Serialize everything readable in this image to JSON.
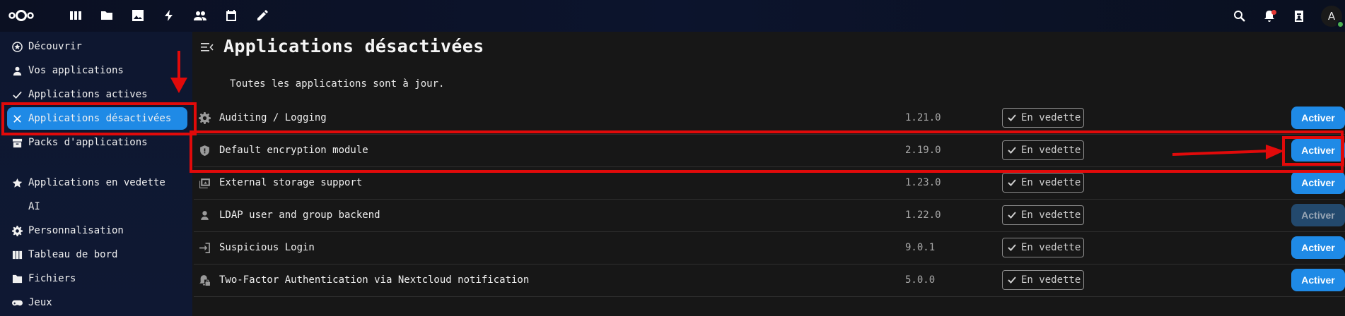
{
  "header": {
    "nav_icons": [
      "dashboard-icon",
      "files-icon",
      "photos-icon",
      "activity-icon",
      "contacts-icon",
      "calendar-icon",
      "notes-icon"
    ],
    "right_icons": [
      "search-icon",
      "notifications-icon",
      "contacts-menu-icon"
    ],
    "avatar_letter": "A"
  },
  "sidebar": {
    "items": [
      {
        "label": "Découvrir",
        "icon": "star-circle-icon"
      },
      {
        "label": "Vos applications",
        "icon": "account-icon"
      },
      {
        "label": "Applications actives",
        "icon": "check-icon"
      },
      {
        "label": "Applications désactivées",
        "icon": "close-icon"
      },
      {
        "label": "Packs d'applications",
        "icon": "archive-icon"
      },
      {
        "label": "Applications en vedette",
        "icon": "star-icon"
      },
      {
        "label": "AI",
        "icon": ""
      },
      {
        "label": "Personnalisation",
        "icon": "cog-icon"
      },
      {
        "label": "Tableau de bord",
        "icon": "dashboard-icon"
      },
      {
        "label": "Fichiers",
        "icon": "folder-icon"
      },
      {
        "label": "Jeux",
        "icon": "gamepad-icon"
      }
    ]
  },
  "main": {
    "title": "Applications désactivées",
    "status": "Toutes les applications sont à jour.",
    "featured_label": "En vedette",
    "activate_label": "Activer",
    "apps": [
      {
        "name": "Auditing / Logging",
        "version": "1.21.0",
        "icon": "cog-icon"
      },
      {
        "name": "Default encryption module",
        "version": "2.19.0",
        "icon": "shield-icon"
      },
      {
        "name": "External storage support",
        "version": "1.23.0",
        "icon": "external-storage-icon"
      },
      {
        "name": "LDAP user and group backend",
        "version": "1.22.0",
        "icon": "user-icon"
      },
      {
        "name": "Suspicious Login",
        "version": "9.0.1",
        "icon": "login-icon"
      },
      {
        "name": "Two-Factor Authentication via Nextcloud notification",
        "version": "5.0.0",
        "icon": "bell-lock-icon"
      }
    ]
  },
  "colors": {
    "accent": "#1f8ae6",
    "annotation": "#e10a0a",
    "header_bg": "#0c142d",
    "main_bg": "#171717"
  }
}
